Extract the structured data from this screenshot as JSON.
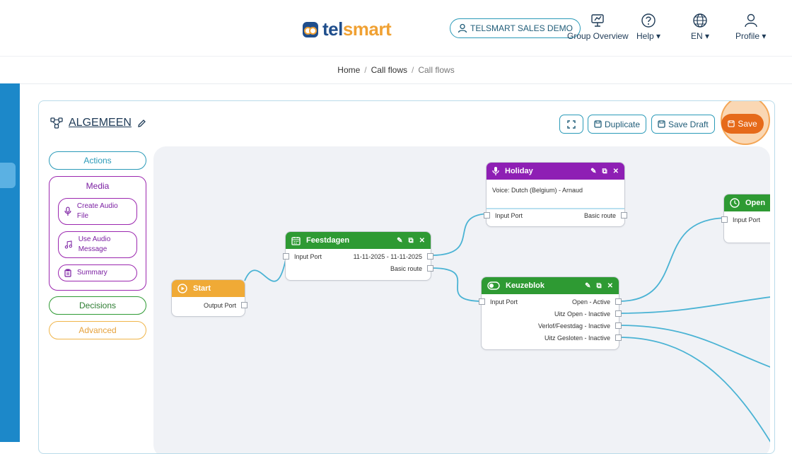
{
  "header": {
    "logo_tel": "tel",
    "logo_smart": "smart",
    "account": "TELSMART SALES DEMO",
    "nav": {
      "group_overview": "Group Overview",
      "help": "Help",
      "language": "EN",
      "profile": "Profile"
    }
  },
  "breadcrumb": {
    "home": "Home",
    "callflows": "Call flows",
    "current": "Call flows"
  },
  "flow": {
    "title": "ALGEMEEN",
    "duplicate": "Duplicate",
    "save_draft": "Save Draft",
    "save": "Save"
  },
  "palette": {
    "actions": "Actions",
    "media": "Media",
    "media_items": [
      "Create Audio File",
      "Use Audio Message",
      "Summary"
    ],
    "decisions": "Decisions",
    "advanced": "Advanced"
  },
  "nodes": {
    "start": {
      "title": "Start",
      "output": "Output Port"
    },
    "feestdagen": {
      "title": "Feestdagen",
      "input": "Input Port",
      "range": "11-11-2025 - 11-11-2025",
      "basic": "Basic route"
    },
    "holiday": {
      "title": "Holiday",
      "voice": "Voice: Dutch (Belgium) - Arnaud",
      "input": "Input Port",
      "basic": "Basic route"
    },
    "keuzeblok": {
      "title": "Keuzeblok",
      "input": "Input Port",
      "outputs": [
        "Open - Active",
        "Uitz Open - Inactive",
        "Verlof/Feestdag - Inactive",
        "Uitz Gesloten - Inactive"
      ]
    },
    "open": {
      "title": "Open",
      "input": "Input Port"
    }
  },
  "colors": {
    "accent": "#1c88c9",
    "save": "#e66a1a",
    "actions": "#2a9ab8",
    "media": "#9b27af",
    "decisions": "#2e9a33",
    "advanced": "#f0b54a",
    "start": "#f0aa36",
    "green": "#2e9a33",
    "purple": "#8e1fb4"
  }
}
